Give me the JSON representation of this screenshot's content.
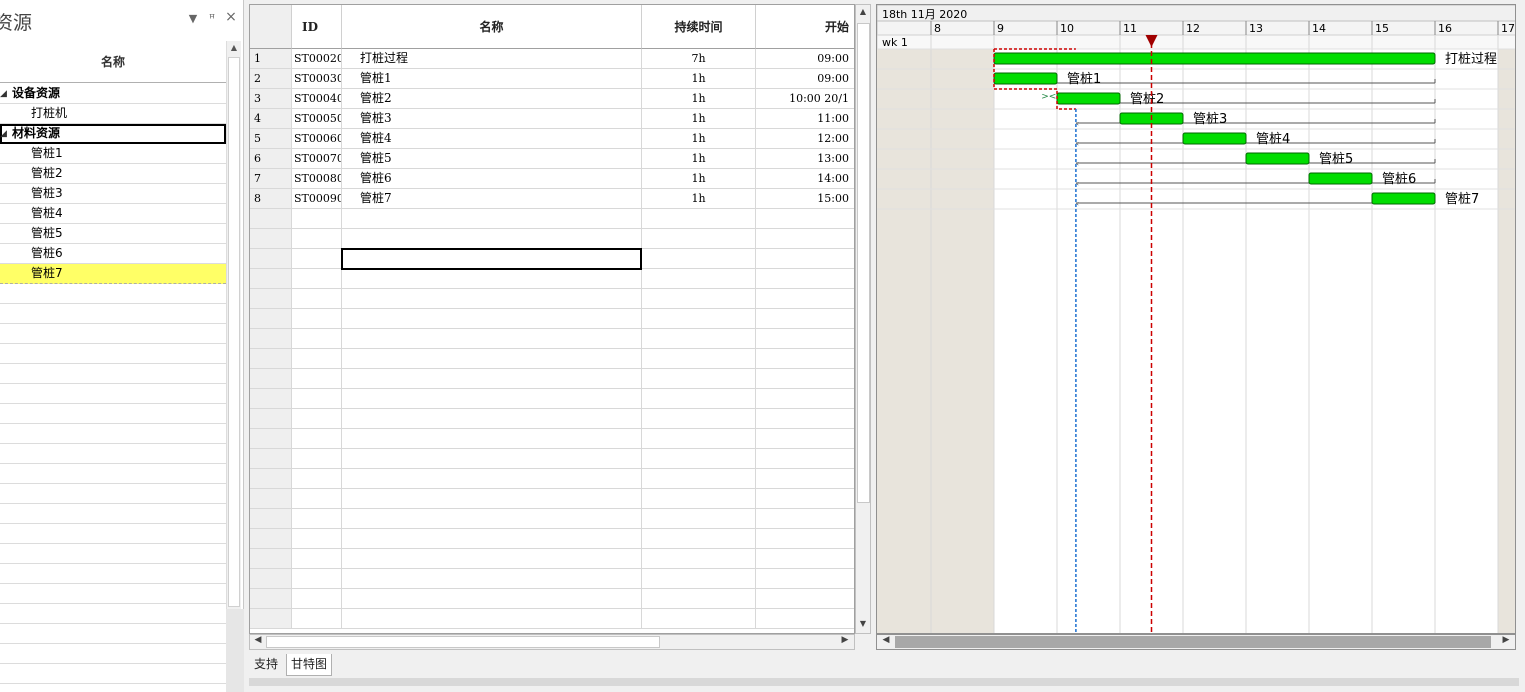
{
  "left_panel": {
    "title": "资源",
    "dropdown_icon": "▼",
    "pin_icon": "ꟸ",
    "close_icon": "×",
    "column_header": "名称",
    "items": [
      {
        "label": "设备资源",
        "group": true
      },
      {
        "label": "打桩机",
        "group": false
      },
      {
        "label": "材料资源",
        "group": true
      },
      {
        "label": "管桩1",
        "group": false
      },
      {
        "label": "管桩2",
        "group": false
      },
      {
        "label": "管桩3",
        "group": false
      },
      {
        "label": "管桩4",
        "group": false
      },
      {
        "label": "管桩5",
        "group": false
      },
      {
        "label": "管桩6",
        "group": false
      },
      {
        "label": "管桩7",
        "group": false
      }
    ]
  },
  "grid": {
    "columns": [
      "ID",
      "名称",
      "持续时间",
      "开始"
    ],
    "rows": [
      {
        "num": "1",
        "id": "ST00020",
        "name": "打桩过程",
        "duration": "7h",
        "start": "09:00"
      },
      {
        "num": "2",
        "id": "ST00030",
        "name": "管桩1",
        "duration": "1h",
        "start": "09:00"
      },
      {
        "num": "3",
        "id": "ST00040",
        "name": "管桩2",
        "duration": "1h",
        "start": "10:00 20/1"
      },
      {
        "num": "4",
        "id": "ST00050",
        "name": "管桩3",
        "duration": "1h",
        "start": "11:00"
      },
      {
        "num": "5",
        "id": "ST00060",
        "name": "管桩4",
        "duration": "1h",
        "start": "12:00"
      },
      {
        "num": "6",
        "id": "ST00070",
        "name": "管桩5",
        "duration": "1h",
        "start": "13:00"
      },
      {
        "num": "7",
        "id": "ST00080",
        "name": "管桩6",
        "duration": "1h",
        "start": "14:00"
      },
      {
        "num": "8",
        "id": "ST00090",
        "name": "管桩7",
        "duration": "1h",
        "start": "15:00"
      }
    ]
  },
  "tabs": [
    "支持",
    "甘特图"
  ],
  "active_tab": "甘特图",
  "gantt": {
    "date_header": "18th 11月 2020",
    "week_label": "wk 1",
    "hours": [
      "8",
      "9",
      "10",
      "11",
      "12",
      "13",
      "14",
      "15",
      "16",
      "17"
    ],
    "current_time_hour": 11.5,
    "dependency_line_hour": 10.3,
    "tasks": [
      {
        "label": "打桩过程",
        "start": 9,
        "end": 16
      },
      {
        "label": "管桩1",
        "start": 9,
        "end": 10
      },
      {
        "label": "管桩2",
        "start": 10,
        "end": 11
      },
      {
        "label": "管桩3",
        "start": 11,
        "end": 12
      },
      {
        "label": "管桩4",
        "start": 12,
        "end": 13
      },
      {
        "label": "管桩5",
        "start": 13,
        "end": 14
      },
      {
        "label": "管桩6",
        "start": 14,
        "end": 15
      },
      {
        "label": "管桩7",
        "start": 15,
        "end": 16
      }
    ],
    "colors": {
      "bar": "#00dd00",
      "bar_border": "#006600",
      "nonwork": "#e8e4dc",
      "today_line": "#cc0000",
      "dep_line": "#1a6fd0"
    }
  }
}
